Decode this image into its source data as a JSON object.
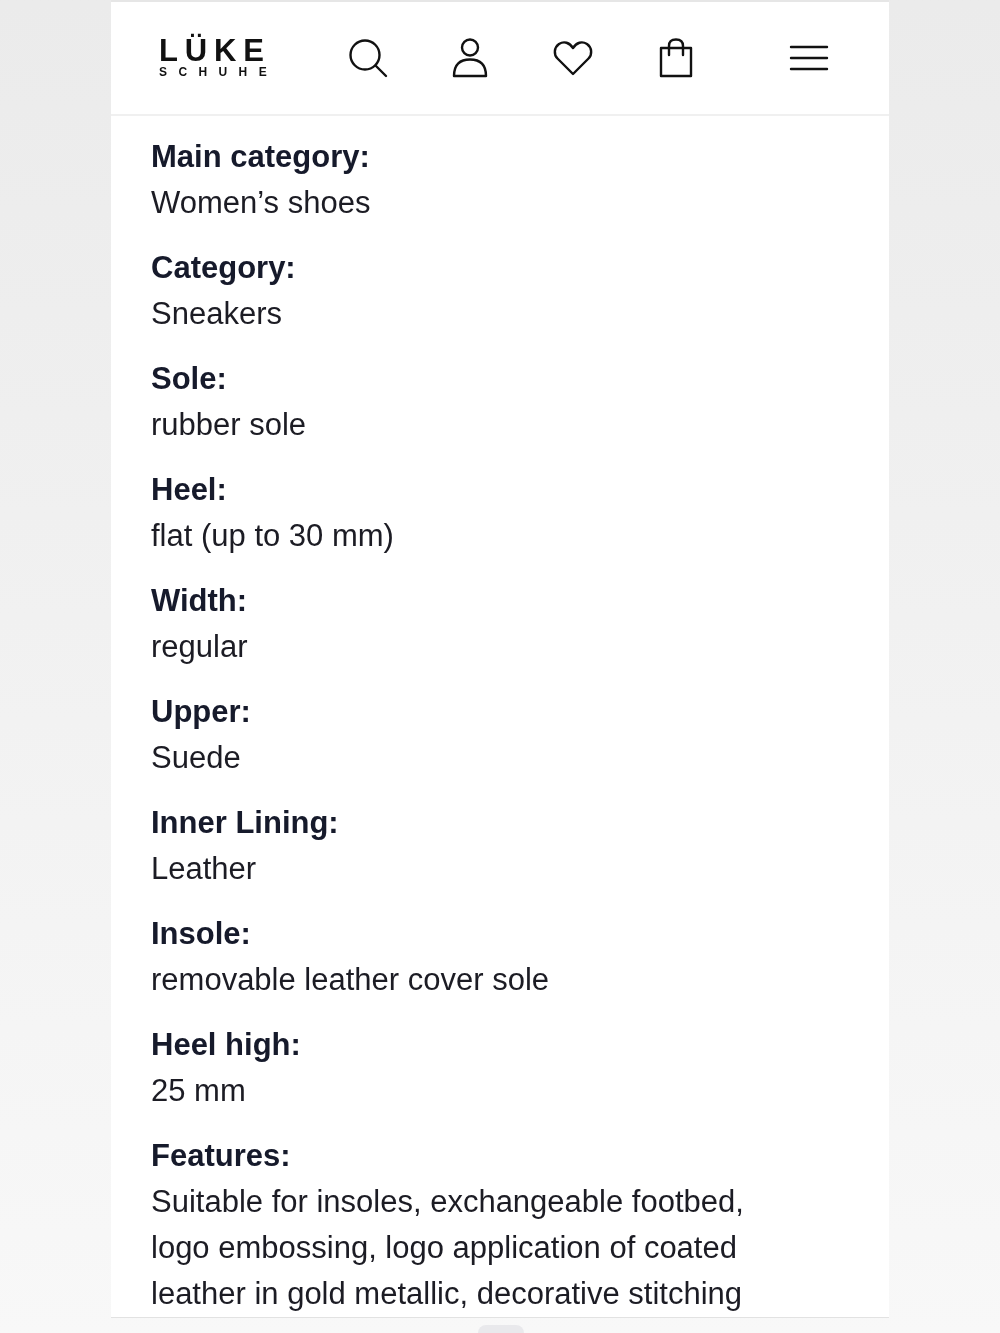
{
  "header": {
    "logo": {
      "wordmark": "LÜKE",
      "tagline": "SCHUHE"
    }
  },
  "details": [
    {
      "label": "Main category:",
      "value": "Women’s shoes"
    },
    {
      "label": "Category:",
      "value": "Sneakers"
    },
    {
      "label": "Sole:",
      "value": "rubber sole"
    },
    {
      "label": "Heel:",
      "value": "flat (up to 30 mm)"
    },
    {
      "label": "Width:",
      "value": "regular"
    },
    {
      "label": "Upper:",
      "value": "Suede"
    },
    {
      "label": "Inner Lining:",
      "value": "Leather"
    },
    {
      "label": "Insole:",
      "value": "removable leather cover sole"
    },
    {
      "label": "Heel high:",
      "value": "25 mm"
    },
    {
      "label": "Features:",
      "value": "Suitable for insoles, exchangeable footbed, logo embossing, logo application of coated leather in gold metallic, decorative stitching"
    }
  ]
}
